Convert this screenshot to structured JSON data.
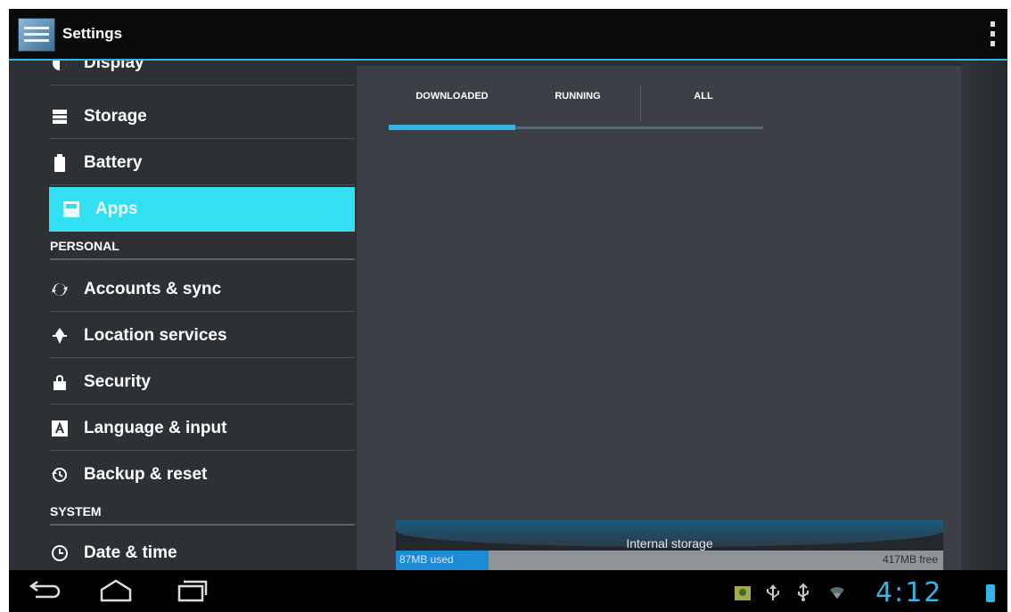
{
  "action_bar": {
    "title": "Settings"
  },
  "settings_list": {
    "partial_item": "Display",
    "items_top": [
      {
        "label": "Storage",
        "icon": "storage-icon"
      },
      {
        "label": "Battery",
        "icon": "battery-icon"
      },
      {
        "label": "Apps",
        "icon": "apps-icon",
        "selected": true
      }
    ],
    "section_personal": "PERSONAL",
    "items_personal": [
      {
        "label": "Accounts & sync",
        "icon": "sync-icon"
      },
      {
        "label": "Location services",
        "icon": "location-icon"
      },
      {
        "label": "Security",
        "icon": "lock-icon"
      },
      {
        "label": "Language & input",
        "icon": "language-icon"
      },
      {
        "label": "Backup & reset",
        "icon": "backup-icon"
      }
    ],
    "section_system": "SYSTEM",
    "items_system": [
      {
        "label": "Date & time",
        "icon": "clock-icon"
      }
    ]
  },
  "apps_pane": {
    "tabs": [
      "DOWNLOADED",
      "RUNNING",
      "ALL"
    ],
    "selected_tab": 0,
    "storage": {
      "label": "Internal storage",
      "used": "87MB used",
      "free": "417MB free",
      "used_fraction": 0.17
    }
  },
  "system_bar": {
    "clock": "4:12",
    "accent_color": "#33b5e5"
  }
}
